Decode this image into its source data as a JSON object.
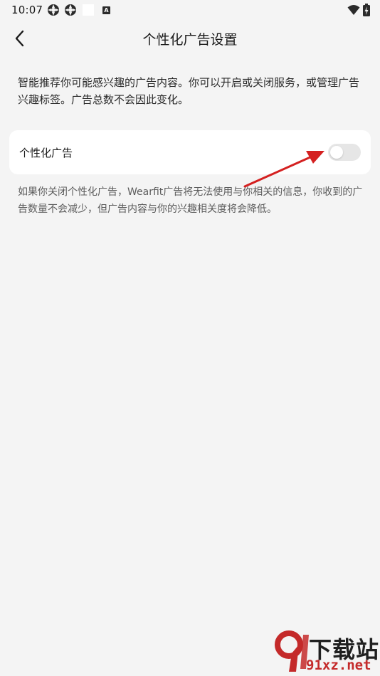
{
  "status_bar": {
    "time": "10:07",
    "a_badge": "A",
    "icons_left": [
      "vpn-key-icon",
      "vpn-key-icon",
      "blank-notification-icon",
      "a-badge-icon"
    ],
    "icons_right": [
      "wifi-icon",
      "battery-charging-icon"
    ]
  },
  "header": {
    "title": "个性化广告设置",
    "back_icon": "chevron-left-icon"
  },
  "intro": {
    "text": "智能推荐你可能感兴趣的广告内容。你可以开启或关闭服务，或管理广告兴趣标签。广告总数不会因此变化。"
  },
  "settings": {
    "personalized_ads": {
      "label": "个性化广告",
      "enabled": false
    }
  },
  "description": {
    "text": "如果你关闭个性化广告，Wearfit广告将无法使用与你相关的信息，你收到的广告数量不会减少，但广告内容与你的兴趣相关度将会降低。"
  },
  "annotation": {
    "type": "arrow",
    "color": "#d42020",
    "points_to": "personalized-ads-toggle"
  },
  "watermark": {
    "brand": "下载站",
    "domain": "91xz.net",
    "logo_color": "#c42a2a"
  },
  "colors": {
    "background": "#f4f4f4",
    "card": "#ffffff",
    "toggle_off": "#e6e6e6",
    "secondary_text": "#5c5c5c"
  }
}
